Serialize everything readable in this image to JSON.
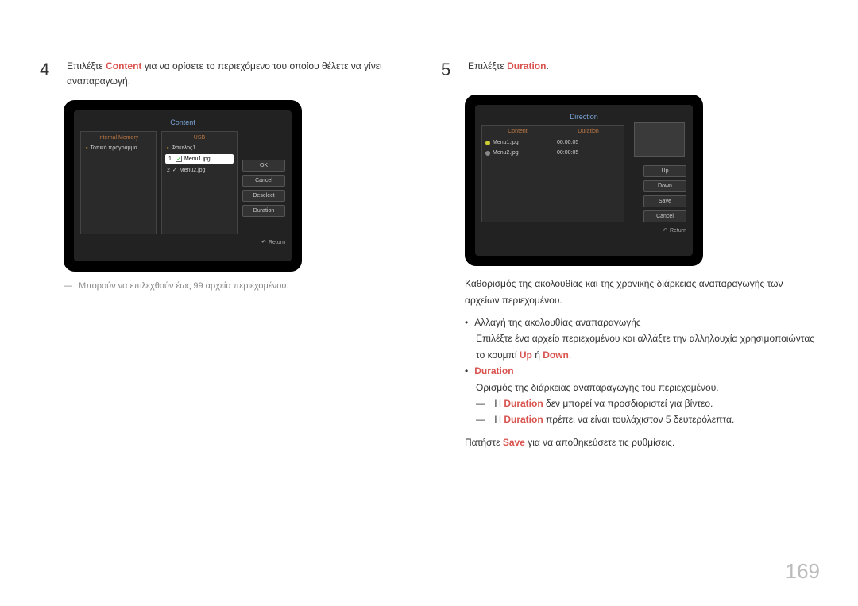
{
  "page_number": "169",
  "left": {
    "step_num": "4",
    "step_text_prefix": "Επιλέξτε ",
    "step_text_hl": "Content",
    "step_text_suffix": " για να ορίσετε το περιεχόμενο του οποίου θέλετε να γίνει αναπαραγωγή.",
    "device": {
      "title": "Content",
      "left_header": "Internal Memory",
      "right_header": "USB",
      "left_item": "Τοπικό πρόγραμμα",
      "right_folder": "Φάκελος1",
      "file1_num": "1",
      "file1": "Menu1.jpg",
      "file2_num": "2",
      "file2": "Menu2.jpg",
      "btn_ok": "OK",
      "btn_cancel": "Cancel",
      "btn_deselect": "Deselect",
      "btn_duration": "Duration",
      "return": "Return"
    },
    "note": "Μπορούν να επιλεχθούν έως 99 αρχεία περιεχομένου."
  },
  "right": {
    "step_num": "5",
    "step_text_prefix": "Επιλέξτε ",
    "step_text_hl": "Duration",
    "step_text_suffix": ".",
    "device": {
      "title": "Direction",
      "col1": "Content",
      "col2": "Duration",
      "row1_name": "Menu1.jpg",
      "row1_dur": "00:00:05",
      "row2_name": "Menu2.jpg",
      "row2_dur": "00:00:05",
      "btn_up": "Up",
      "btn_down": "Down",
      "btn_save": "Save",
      "btn_cancel": "Cancel",
      "return": "Return"
    },
    "p1": "Καθορισμός της ακολουθίας και της χρονικής διάρκειας αναπαραγωγής των αρχείων περιεχομένου.",
    "bullet1": "Αλλαγή της ακολουθίας αναπαραγωγής",
    "bullet1_sub_a": "Επιλέξτε ένα αρχείο περιεχομένου και αλλάξτε την αλληλουχία χρησιμοποιώντας το κουμπί ",
    "bullet1_sub_up": "Up",
    "bullet1_sub_or": " ή ",
    "bullet1_sub_down": "Down",
    "bullet1_sub_end": ".",
    "bullet2_hl": "Duration",
    "bullet2_sub": "Ορισμός της διάρκειας αναπαραγωγής του περιεχομένου.",
    "dash1_a": "Η ",
    "dash1_hl": "Duration",
    "dash1_b": " δεν μπορεί να προσδιοριστεί για βίντεο.",
    "dash2_a": "Η ",
    "dash2_hl": "Duration",
    "dash2_b": " πρέπει να είναι τουλάχιστον 5 δευτερόλεπτα.",
    "p2_a": "Πατήστε ",
    "p2_hl": "Save",
    "p2_b": " για να αποθηκεύσετε τις ρυθμίσεις."
  }
}
